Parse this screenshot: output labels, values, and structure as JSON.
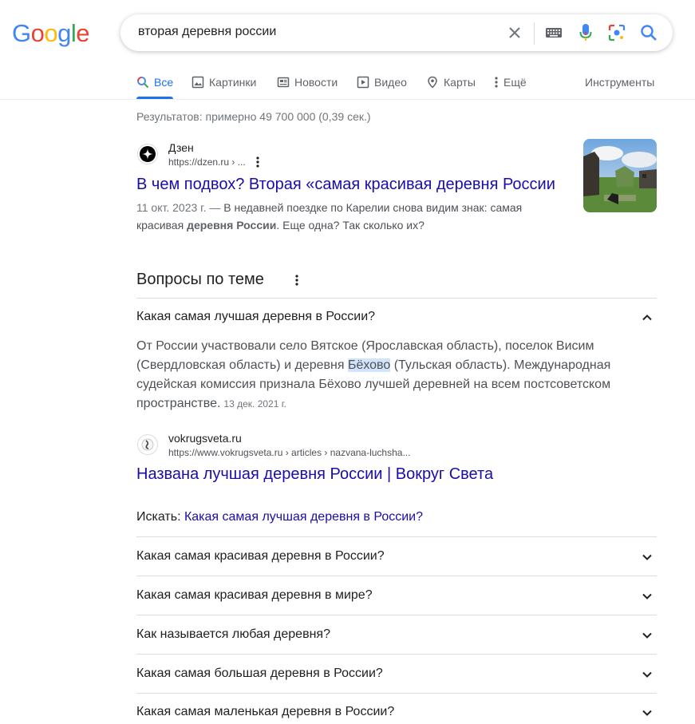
{
  "logo": {
    "letters": [
      "G",
      "o",
      "o",
      "g",
      "l",
      "e"
    ],
    "colors": [
      "#4285f4",
      "#ea4335",
      "#fbbc05",
      "#4285f4",
      "#34a853",
      "#ea4335"
    ]
  },
  "search": {
    "query": "вторая деревня россии"
  },
  "tabs": [
    {
      "label": "Все",
      "icon": "search-icon",
      "active": true
    },
    {
      "label": "Картинки",
      "icon": "image-icon"
    },
    {
      "label": "Новости",
      "icon": "news-icon"
    },
    {
      "label": "Видео",
      "icon": "video-icon"
    },
    {
      "label": "Карты",
      "icon": "map-pin-icon"
    },
    {
      "label": "Ещё",
      "icon": "more-vert-icon"
    }
  ],
  "tools_label": "Инструменты",
  "stats": "Результатов: примерно 49 700 000 (0,39 сек.)",
  "result1": {
    "site": "Дзен",
    "url": "https://dzen.ru › ...",
    "title": "В чем подвох? Вторая «самая красивая деревня России",
    "date": "11 окт. 2023 г. — ",
    "snippet_a": "В недавней поездке по Карелии снова видим знак: самая красивая ",
    "snippet_bold": "деревня России",
    "snippet_b": ". Еще одна? Так сколько их?"
  },
  "paa": {
    "title": "Вопросы по теме",
    "expanded": {
      "question": "Какая самая лучшая деревня в России?",
      "answer_a": "От России участвовали село Вятское (Ярославская область), поселок Висим (Свердловская область) и деревня ",
      "answer_highlight": "Бёхово",
      "answer_b": " (Тульская область). Международная судейская комиссия признала Бёхово лучшей деревней на всем постсоветском пространстве.",
      "date": "13 дек. 2021 г.",
      "source_site": "vokrugsveta.ru",
      "source_url": "https://www.vokrugsveta.ru › articles › nazvana-luchsha...",
      "source_title": "Названа лучшая деревня России | Вокруг Света",
      "search_label": "Искать: ",
      "search_link": "Какая самая лучшая деревня в России?"
    },
    "questions": [
      "Какая самая красивая деревня в России?",
      "Какая самая красивая деревня в мире?",
      "Как называется любая деревня?",
      "Какая самая большая деревня в России?",
      "Какая самая маленькая деревня в России?"
    ]
  }
}
